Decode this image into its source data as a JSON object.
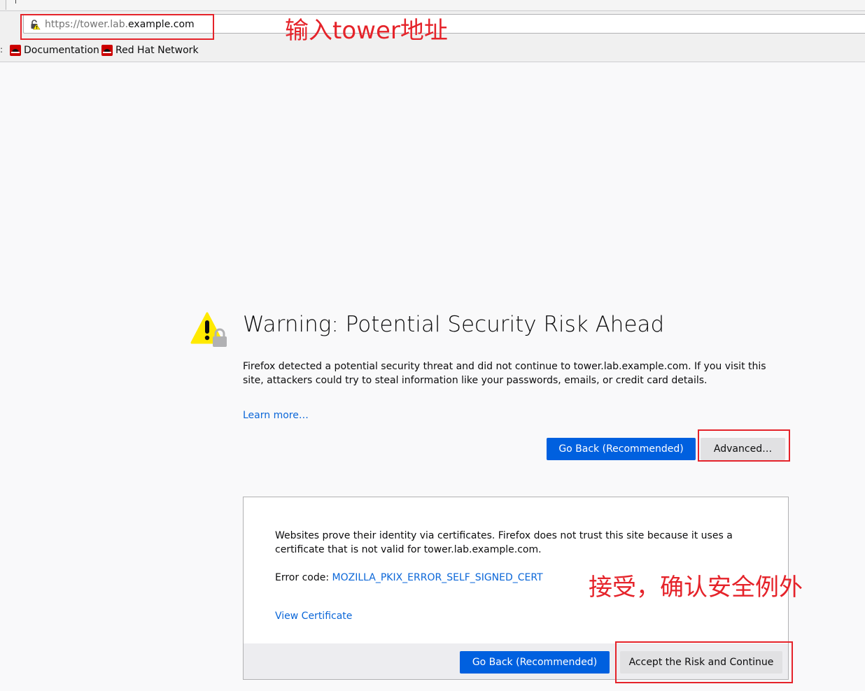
{
  "browser": {
    "url_scheme": "https://",
    "url_subdomain": "tower.lab.",
    "url_host": "example.com",
    "bookmarks": [
      {
        "label": "Documentation"
      },
      {
        "label": "Red Hat Network"
      }
    ]
  },
  "error_page": {
    "title": "Warning: Potential Security Risk Ahead",
    "intro": "Firefox detected a potential security threat and did not continue to tower.lab.example.com. If you visit this site, attackers could try to steal information like your passwords, emails, or credit card details.",
    "learn_more": "Learn more…",
    "go_back_label": "Go Back (Recommended)",
    "advanced_label": "Advanced…",
    "advanced_panel": {
      "text": "Websites prove their identity via certificates. Firefox does not trust this site because it uses a certificate that is not valid for tower.lab.example.com.",
      "error_code_label": "Error code: ",
      "error_code": "MOZILLA_PKIX_ERROR_SELF_SIGNED_CERT",
      "view_certificate": "View Certificate",
      "go_back_label": "Go Back (Recommended)",
      "accept_label": "Accept the Risk and Continue"
    }
  },
  "annotations": {
    "enter_address": "输入tower地址",
    "accept_exception": "接受，确认安全例外"
  },
  "colors": {
    "accent": "#0060df",
    "link": "#0a66d8",
    "annotation": "#e5232a",
    "warning": "#ffe900"
  }
}
